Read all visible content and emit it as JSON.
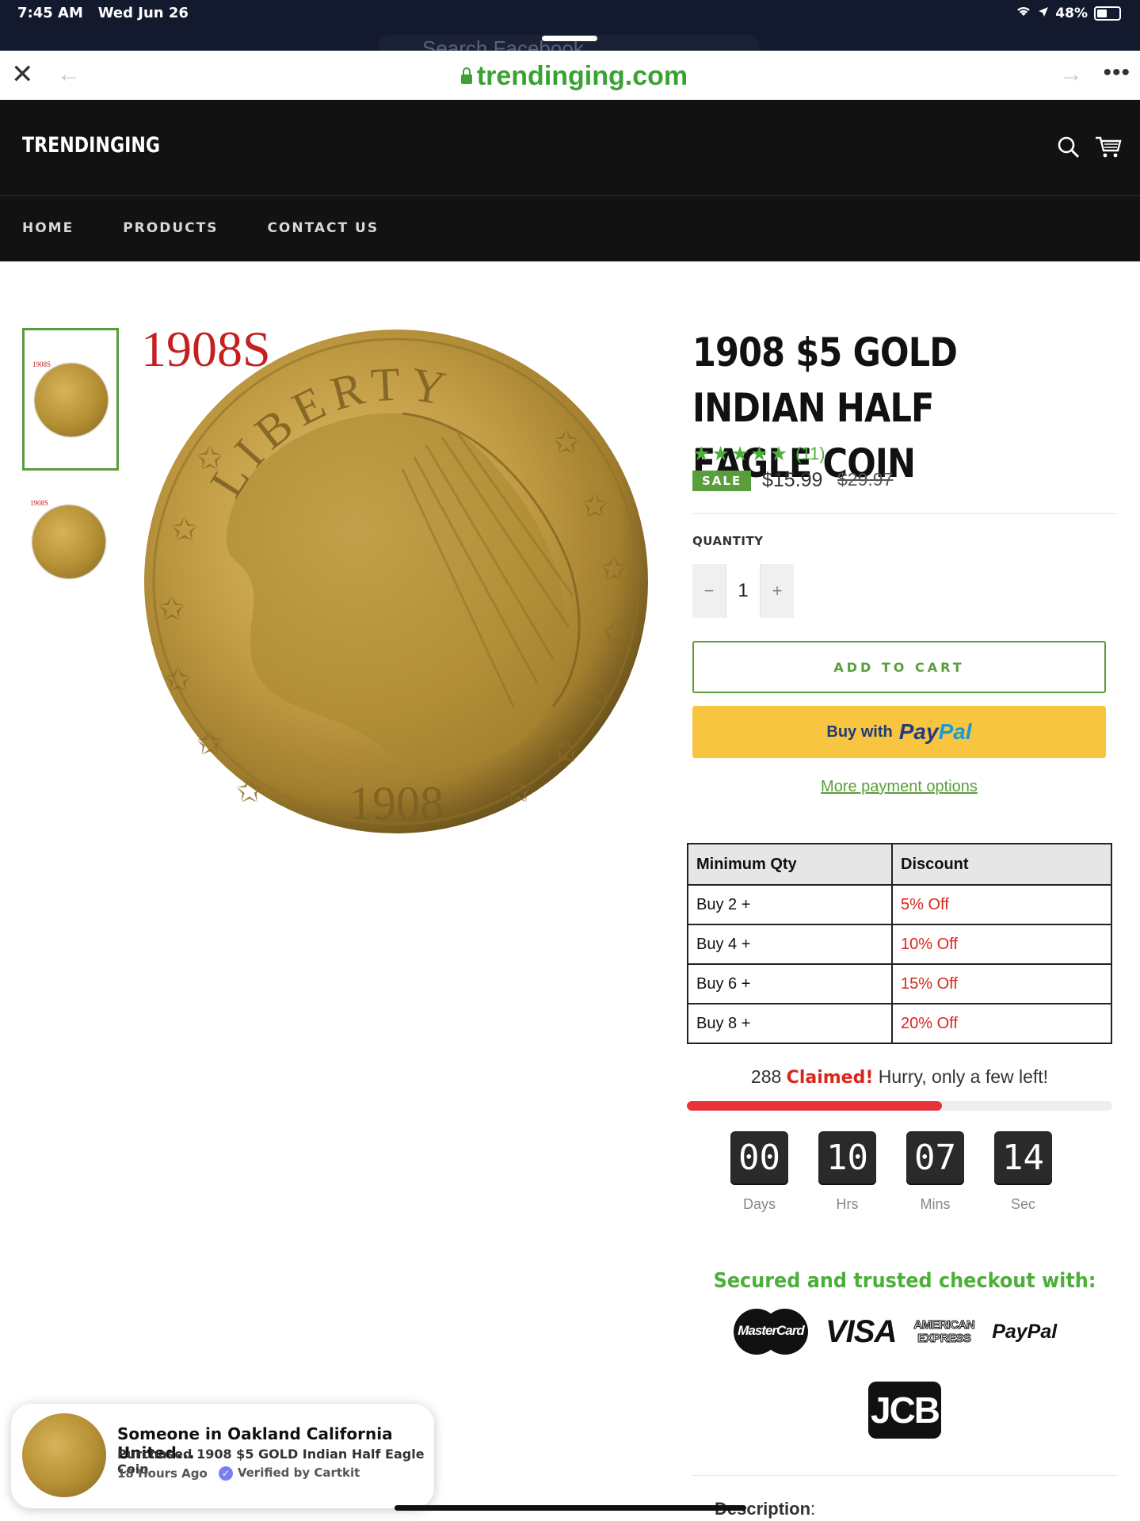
{
  "status": {
    "time": "7:45 AM",
    "date": "Wed Jun 26",
    "battery": "48%"
  },
  "browser": {
    "url": "trendinging.com",
    "ghost_text": "Search Facebook"
  },
  "site": {
    "brand": "TRENDINGING",
    "nav": [
      "HOME",
      "PRODUCTS",
      "CONTACT US"
    ]
  },
  "gallery": {
    "image_label": "1908S",
    "thumb_label": "1908S"
  },
  "product": {
    "title": "1908 $5 GOLD INDIAN HALF EAGLE COIN",
    "rating": 5,
    "review_count": "(11)",
    "sale_badge": "SALE",
    "price": "$15.99",
    "compare_price": "$29.97",
    "quantity_label": "QUANTITY",
    "quantity_minus": "−",
    "quantity": "1",
    "quantity_plus": "+",
    "add_to_cart": "ADD TO CART",
    "paypal_prefix": "Buy with",
    "paypal_pay": "Pay",
    "paypal_pal": "Pal",
    "more_payment": "More payment options"
  },
  "discount_table": {
    "headers": [
      "Minimum Qty",
      "Discount"
    ],
    "rows": [
      {
        "qty": "Buy 2 +",
        "discount": "5% Off"
      },
      {
        "qty": "Buy 4 +",
        "discount": "10% Off"
      },
      {
        "qty": "Buy 6 +",
        "discount": "15% Off"
      },
      {
        "qty": "Buy 8 +",
        "discount": "20% Off"
      }
    ]
  },
  "scarcity": {
    "count": "288",
    "claimed": "Claimed!",
    "hurry": "Hurry, only a few left!",
    "progress": 0.6
  },
  "countdown": [
    {
      "value": "00",
      "label": "Days"
    },
    {
      "value": "10",
      "label": "Hrs"
    },
    {
      "value": "07",
      "label": "Mins"
    },
    {
      "value": "14",
      "label": "Sec"
    }
  ],
  "trust": {
    "heading": "Secured and trusted checkout with:",
    "mastercard": "MasterCard",
    "visa": "VISA",
    "amex_1": "AMERICAN",
    "amex_2": "EXPRESS",
    "paypal": "PayPal",
    "jcb": "JCB"
  },
  "description_label": "Description",
  "description_colon": ":",
  "popup": {
    "line1": "Someone in Oakland California United...",
    "line2": "Purchased 1908 $5 GOLD Indian Half Eagle Coin",
    "time": "18 Hours Ago",
    "verified": "Verified by Cartkit"
  },
  "colors": {
    "accent": "#5a9e3c",
    "sale_red": "#d9261c",
    "header": "#121212",
    "paypal_yellow": "#f7c53f"
  }
}
